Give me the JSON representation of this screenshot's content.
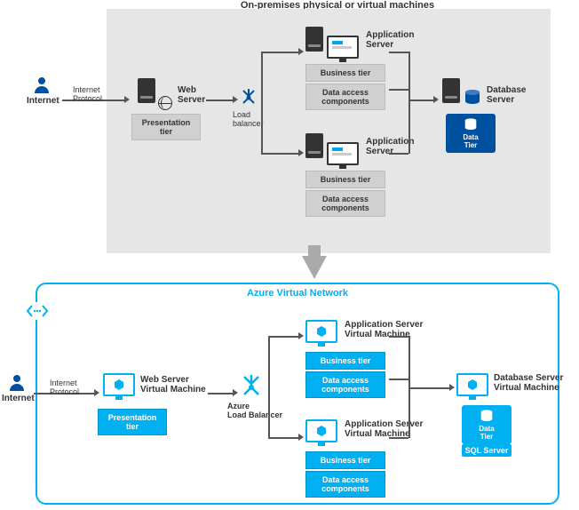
{
  "top": {
    "title": "On-premises physical or virtual machines",
    "internet": "Internet",
    "internet_protocol": "Internet\nProtocol",
    "web_server": "Web\nServer",
    "presentation_tier": "Presentation\ntier",
    "load_balancer": "Load\nbalancer",
    "app_server": "Application\nServer",
    "business_tier": "Business tier",
    "data_access": "Data access\ncomponents",
    "db_server": "Database\nServer",
    "data_tier": "Data\nTier"
  },
  "bottom": {
    "title": "Azure Virtual Network",
    "internet": "Internet",
    "internet_protocol": "Internet\nProtocol",
    "web_server_vm": "Web Server\nVirtual Machine",
    "presentation_tier": "Presentation\ntier",
    "azure_lb": "Azure\nLoad Balancer",
    "app_server_vm": "Application Server\nVirtual Machine",
    "business_tier": "Business tier",
    "data_access": "Data access\ncomponents",
    "db_server_vm": "Database Server\nVirtual Machine",
    "data_tier": "Data\nTier",
    "sql_server": "SQL Server"
  }
}
